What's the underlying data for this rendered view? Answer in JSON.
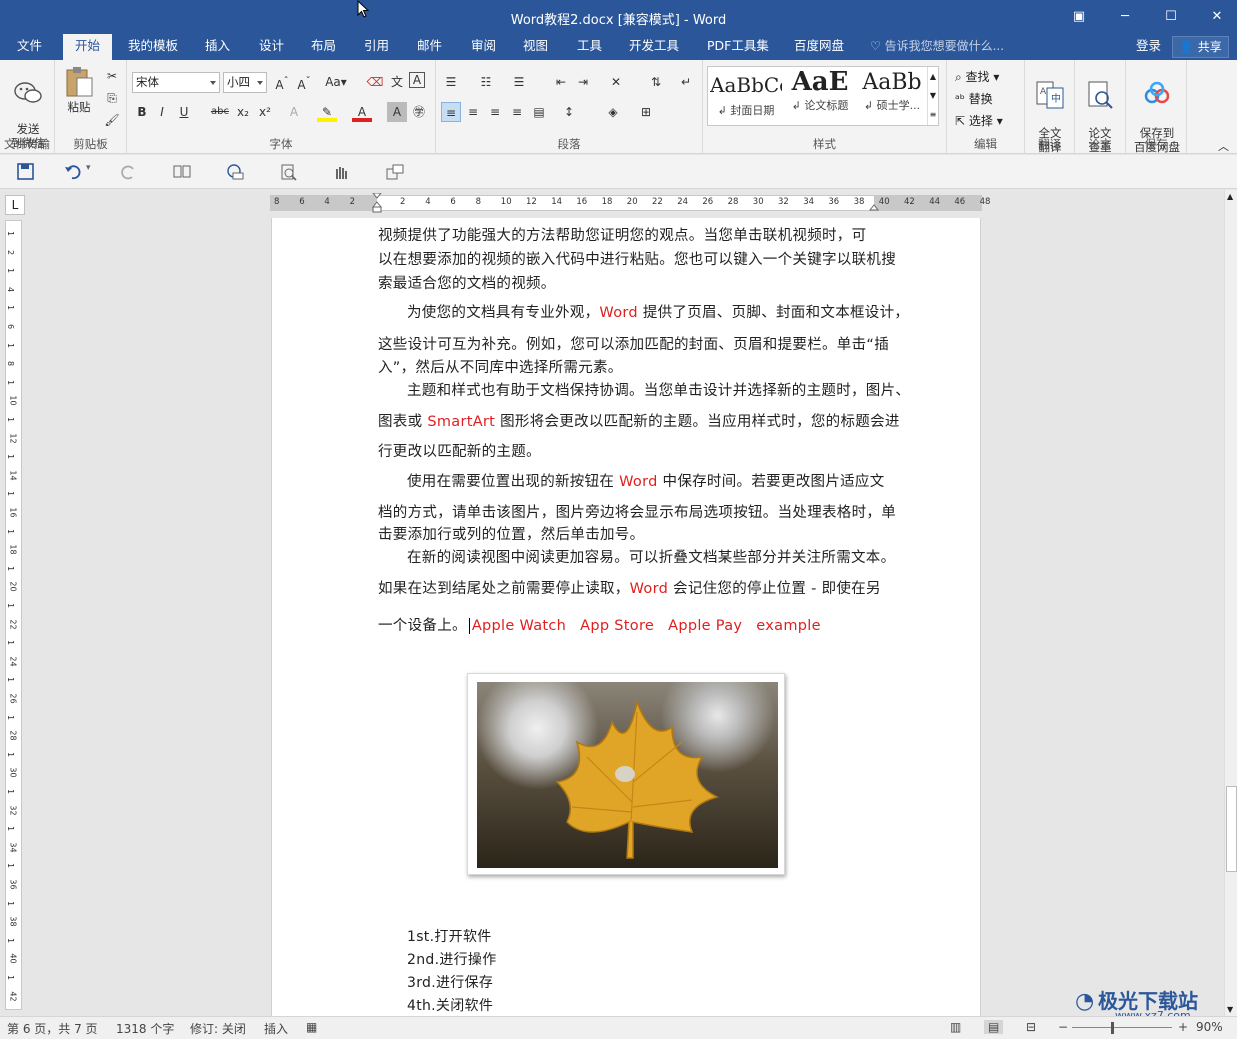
{
  "window": {
    "title": "Word教程2.docx [兼容模式] - Word",
    "restore": "▣",
    "minimize": "─",
    "maximize": "☐",
    "close": "✕"
  },
  "tabs": [
    "文件",
    "开始",
    "我的模板",
    "插入",
    "设计",
    "布局",
    "引用",
    "邮件",
    "审阅",
    "视图",
    "工具",
    "开发工具",
    "PDF工具集",
    "百度网盘"
  ],
  "tell_me": "告诉我您想要做什么...",
  "login": "登录",
  "share": "共享",
  "ribbon": {
    "send_wechat": "发送\n到微信",
    "file_transfer": "文件传输",
    "paste": "粘贴",
    "clipboard": "剪贴板",
    "font_name": "宋体",
    "font_size": "小四",
    "font_group": "字体",
    "paragraph_group": "段落",
    "styles_group": "样式",
    "styles": [
      {
        "preview": "AaBbCc",
        "name": "↲ 封面日期"
      },
      {
        "preview": "AaE",
        "name": "↲ 论文标题"
      },
      {
        "preview": "AaBb",
        "name": "↲ 硕士学..."
      }
    ],
    "find": "查找",
    "replace": "替换",
    "select": "选择",
    "edit_group": "编辑",
    "full_translate": "全文\n翻译",
    "translate_group": "翻译",
    "paper_check": "论文\n查重",
    "paper_group": "论文",
    "save_baidu": "保存到\n百度网盘",
    "save_group": "保存"
  },
  "ruler_h": [
    "8",
    "6",
    "4",
    "2",
    "",
    "2",
    "4",
    "6",
    "8",
    "10",
    "12",
    "14",
    "16",
    "18",
    "20",
    "22",
    "24",
    "26",
    "28",
    "30",
    "32",
    "34",
    "36",
    "38",
    "40",
    "42",
    "44",
    "46",
    "48"
  ],
  "ruler_v": [
    "1",
    "2",
    "1",
    "4",
    "1",
    "6",
    "1",
    "8",
    "1",
    "10",
    "1",
    "12",
    "1",
    "14",
    "1",
    "16",
    "1",
    "18",
    "1",
    "20",
    "1",
    "22",
    "1",
    "24",
    "1",
    "26",
    "1",
    "28",
    "1",
    "30",
    "1",
    "32",
    "1",
    "34",
    "1",
    "36",
    "1",
    "38",
    "1",
    "40",
    "1",
    "42"
  ],
  "doc": {
    "p1_l1": "视频提供了功能强大的方法帮助您证明您的观点。当您单击联机视频时，可",
    "p1_l2": "以在想要添加的视频的嵌入代码中进行粘贴。您也可以键入一个关键字以联机搜",
    "p1_l3": "索最适合您的文档的视频。",
    "p2_l1a": "为使您的文档具有专业外观，",
    "p2_l1w": "Word",
    "p2_l1b": "提供了页眉、页脚、封面和文本框设计，",
    "p2_l2": "这些设计可互为补充。例如，您可以添加匹配的封面、页眉和提要栏。单击“插",
    "p2_l3": "入”，然后从不同库中选择所需元素。",
    "p3_l1": "主题和样式也有助于文档保持协调。当您单击设计并选择新的主题时，图片、",
    "p3_l2a": "图表或",
    "p3_l2w": "SmartArt",
    "p3_l2b": "图形将会更改以匹配新的主题。当应用样式时，您的标题会进",
    "p3_l3": "行更改以匹配新的主题。",
    "p4_l1a": "使用在需要位置出现的新按钮在",
    "p4_l1w": "Word",
    "p4_l1b": "中保存时间。若要更改图片适应文",
    "p4_l2": "档的方式，请单击该图片，图片旁边将会显示布局选项按钮。当处理表格时，单",
    "p4_l3": "击要添加行或列的位置，然后单击加号。",
    "p5_l1": "在新的阅读视图中阅读更加容易。可以折叠文档某些部分并关注所需文本。",
    "p5_l2a": "如果在达到结尾处之前需要停止读取，",
    "p5_l2w": "Word",
    "p5_l2b": "会记住您的停止位置 - 即使在另",
    "p5_l3": "一个设备上。",
    "links": [
      "Apple Watch",
      "App Store",
      "Apple Pay",
      "example"
    ],
    "list": [
      "1st.打开软件",
      "2nd.进行操作",
      "3rd.进行保存",
      "4th.关闭软件"
    ]
  },
  "status": {
    "page": "第 6 页，共 7 页",
    "words": "1318 个字",
    "revision": "修订: 关闭",
    "insert": "插入",
    "zoom": "90%"
  },
  "watermark": "极光下载站",
  "watermark_url": "www.xz7.com",
  "colors": {
    "accent": "#2b579a",
    "red_text": "#e02020"
  }
}
